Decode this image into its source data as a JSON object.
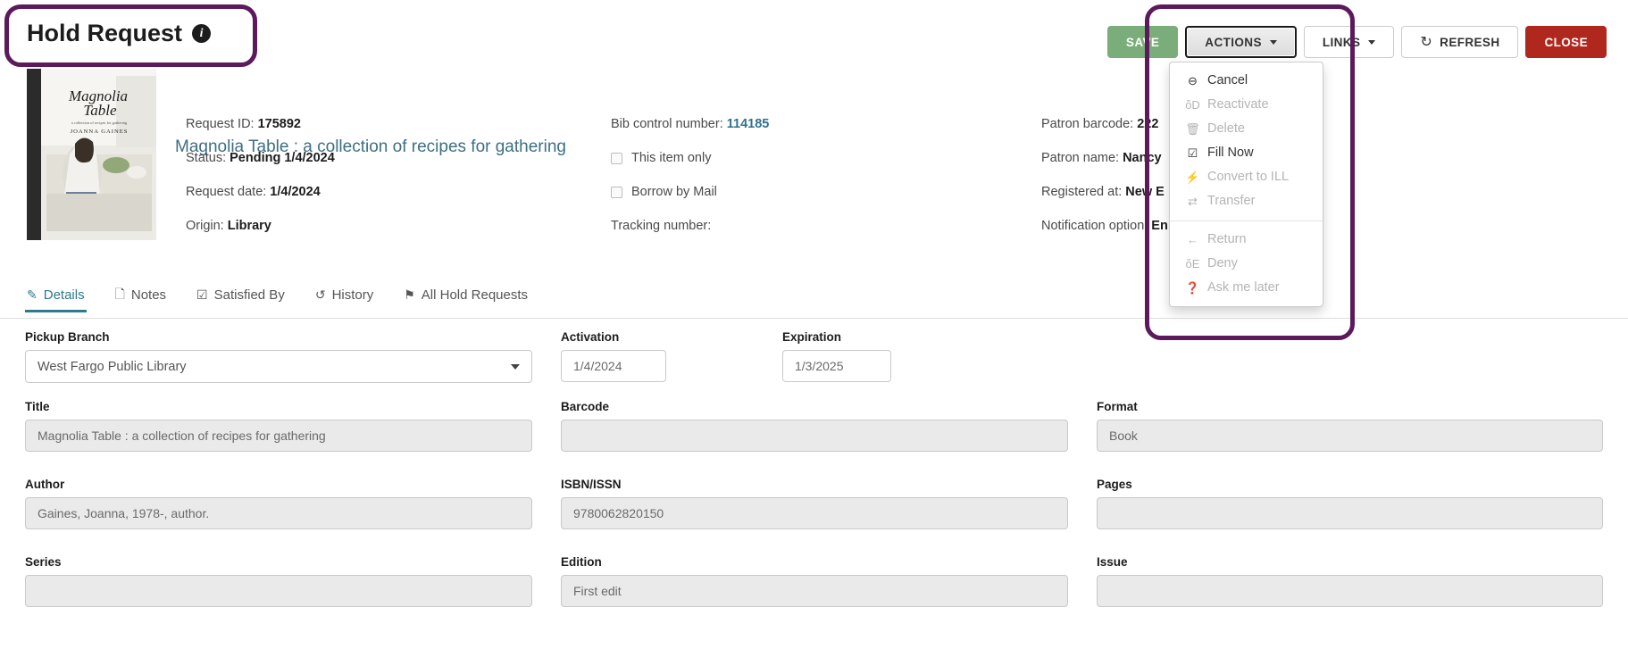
{
  "header": {
    "title": "Hold Request",
    "info_icon": "info-circle-icon"
  },
  "toolbar": {
    "save": "SAVE",
    "actions": "ACTIONS",
    "links": "LINKS",
    "refresh": "REFRESH",
    "close": "CLOSE",
    "refresh_icon": "refresh-icon",
    "colors": {
      "save_bg": "#7aad79",
      "close_bg": "#b0271d",
      "annotation": "#5c1a5c",
      "accent_teal": "#2e7a8c",
      "link_blue": "#31708f"
    }
  },
  "actions_menu": {
    "items": [
      {
        "label": "Cancel",
        "icon": "minus-circle-icon",
        "glyph": "⊖",
        "disabled": false
      },
      {
        "label": "Reactivate",
        "icon": "thumbs-up-icon",
        "glyph": "ὄD",
        "disabled": true
      },
      {
        "label": "Delete",
        "icon": "trash-icon",
        "glyph": "🗑",
        "disabled": true
      },
      {
        "label": "Fill Now",
        "icon": "checkbox-check-icon",
        "glyph": "☑",
        "disabled": false
      },
      {
        "label": "Convert to ILL",
        "icon": "bolt-icon",
        "glyph": "⚡",
        "disabled": true
      },
      {
        "label": "Transfer",
        "icon": "transfer-arrows-icon",
        "glyph": "⇄",
        "disabled": true
      },
      {
        "label": "Return",
        "icon": "arrow-left-icon",
        "glyph": "←",
        "disabled": true
      },
      {
        "label": "Deny",
        "icon": "thumbs-down-icon",
        "glyph": "ὄE",
        "disabled": true
      },
      {
        "label": "Ask me later",
        "icon": "question-circle-icon",
        "glyph": "❓",
        "disabled": true
      }
    ],
    "separator_after_index": 5
  },
  "record": {
    "bib_title": "Magnolia Table : a collection of recipes for gathering",
    "cover_alt": "Magnolia Table book cover",
    "cover_title_line1": "Magnolia",
    "cover_title_line2": "Table",
    "cover_sub": "a collection of recipes for gathering",
    "cover_author": "JOANNA GAINES",
    "col1": [
      {
        "label": "Request ID:",
        "value": "175892"
      },
      {
        "label": "Status:",
        "value": "Pending 1/4/2024"
      },
      {
        "label": "Request date:",
        "value": "1/4/2024"
      },
      {
        "label": "Origin:",
        "value": "Library"
      }
    ],
    "col2": {
      "bib_control_label": "Bib control number:",
      "bib_control_value": "114185",
      "checkbox_this_item_only": "This item only",
      "checkbox_borrow_by_mail": "Borrow by Mail",
      "tracking_label": "Tracking number:",
      "tracking_value": ""
    },
    "col3": [
      {
        "label": "Patron barcode:",
        "value": "222"
      },
      {
        "label": "Patron name:",
        "value": "Nancy"
      },
      {
        "label": "Registered at:",
        "value": "New E"
      },
      {
        "label": "Notification option:",
        "value": "En"
      }
    ]
  },
  "tabs": [
    {
      "label": "Details",
      "icon": "edit-square-icon",
      "glyph": "✎",
      "active": true
    },
    {
      "label": "Notes",
      "icon": "file-icon",
      "glyph": "🗋",
      "active": false
    },
    {
      "label": "Satisfied By",
      "icon": "checkbox-check-icon",
      "glyph": "☑",
      "active": false
    },
    {
      "label": "History",
      "icon": "history-clock-icon",
      "glyph": "↺",
      "active": false
    },
    {
      "label": "All Hold Requests",
      "icon": "flag-icon",
      "glyph": "⚑",
      "active": false
    }
  ],
  "form": {
    "pickup_branch": {
      "label": "Pickup Branch",
      "value": "West Fargo Public Library"
    },
    "activation": {
      "label": "Activation",
      "value": "1/4/2024"
    },
    "expiration": {
      "label": "Expiration",
      "value": "1/3/2025"
    },
    "title": {
      "label": "Title",
      "value": "Magnolia Table : a collection of recipes for gathering"
    },
    "barcode": {
      "label": "Barcode",
      "value": ""
    },
    "format": {
      "label": "Format",
      "value": "Book"
    },
    "author": {
      "label": "Author",
      "value": "Gaines, Joanna, 1978-, author."
    },
    "isbn": {
      "label": "ISBN/ISSN",
      "value": "9780062820150"
    },
    "pages": {
      "label": "Pages",
      "value": ""
    },
    "series": {
      "label": "Series",
      "value": ""
    },
    "edition": {
      "label": "Edition",
      "value": "First edit"
    },
    "issue": {
      "label": "Issue",
      "value": ""
    }
  }
}
